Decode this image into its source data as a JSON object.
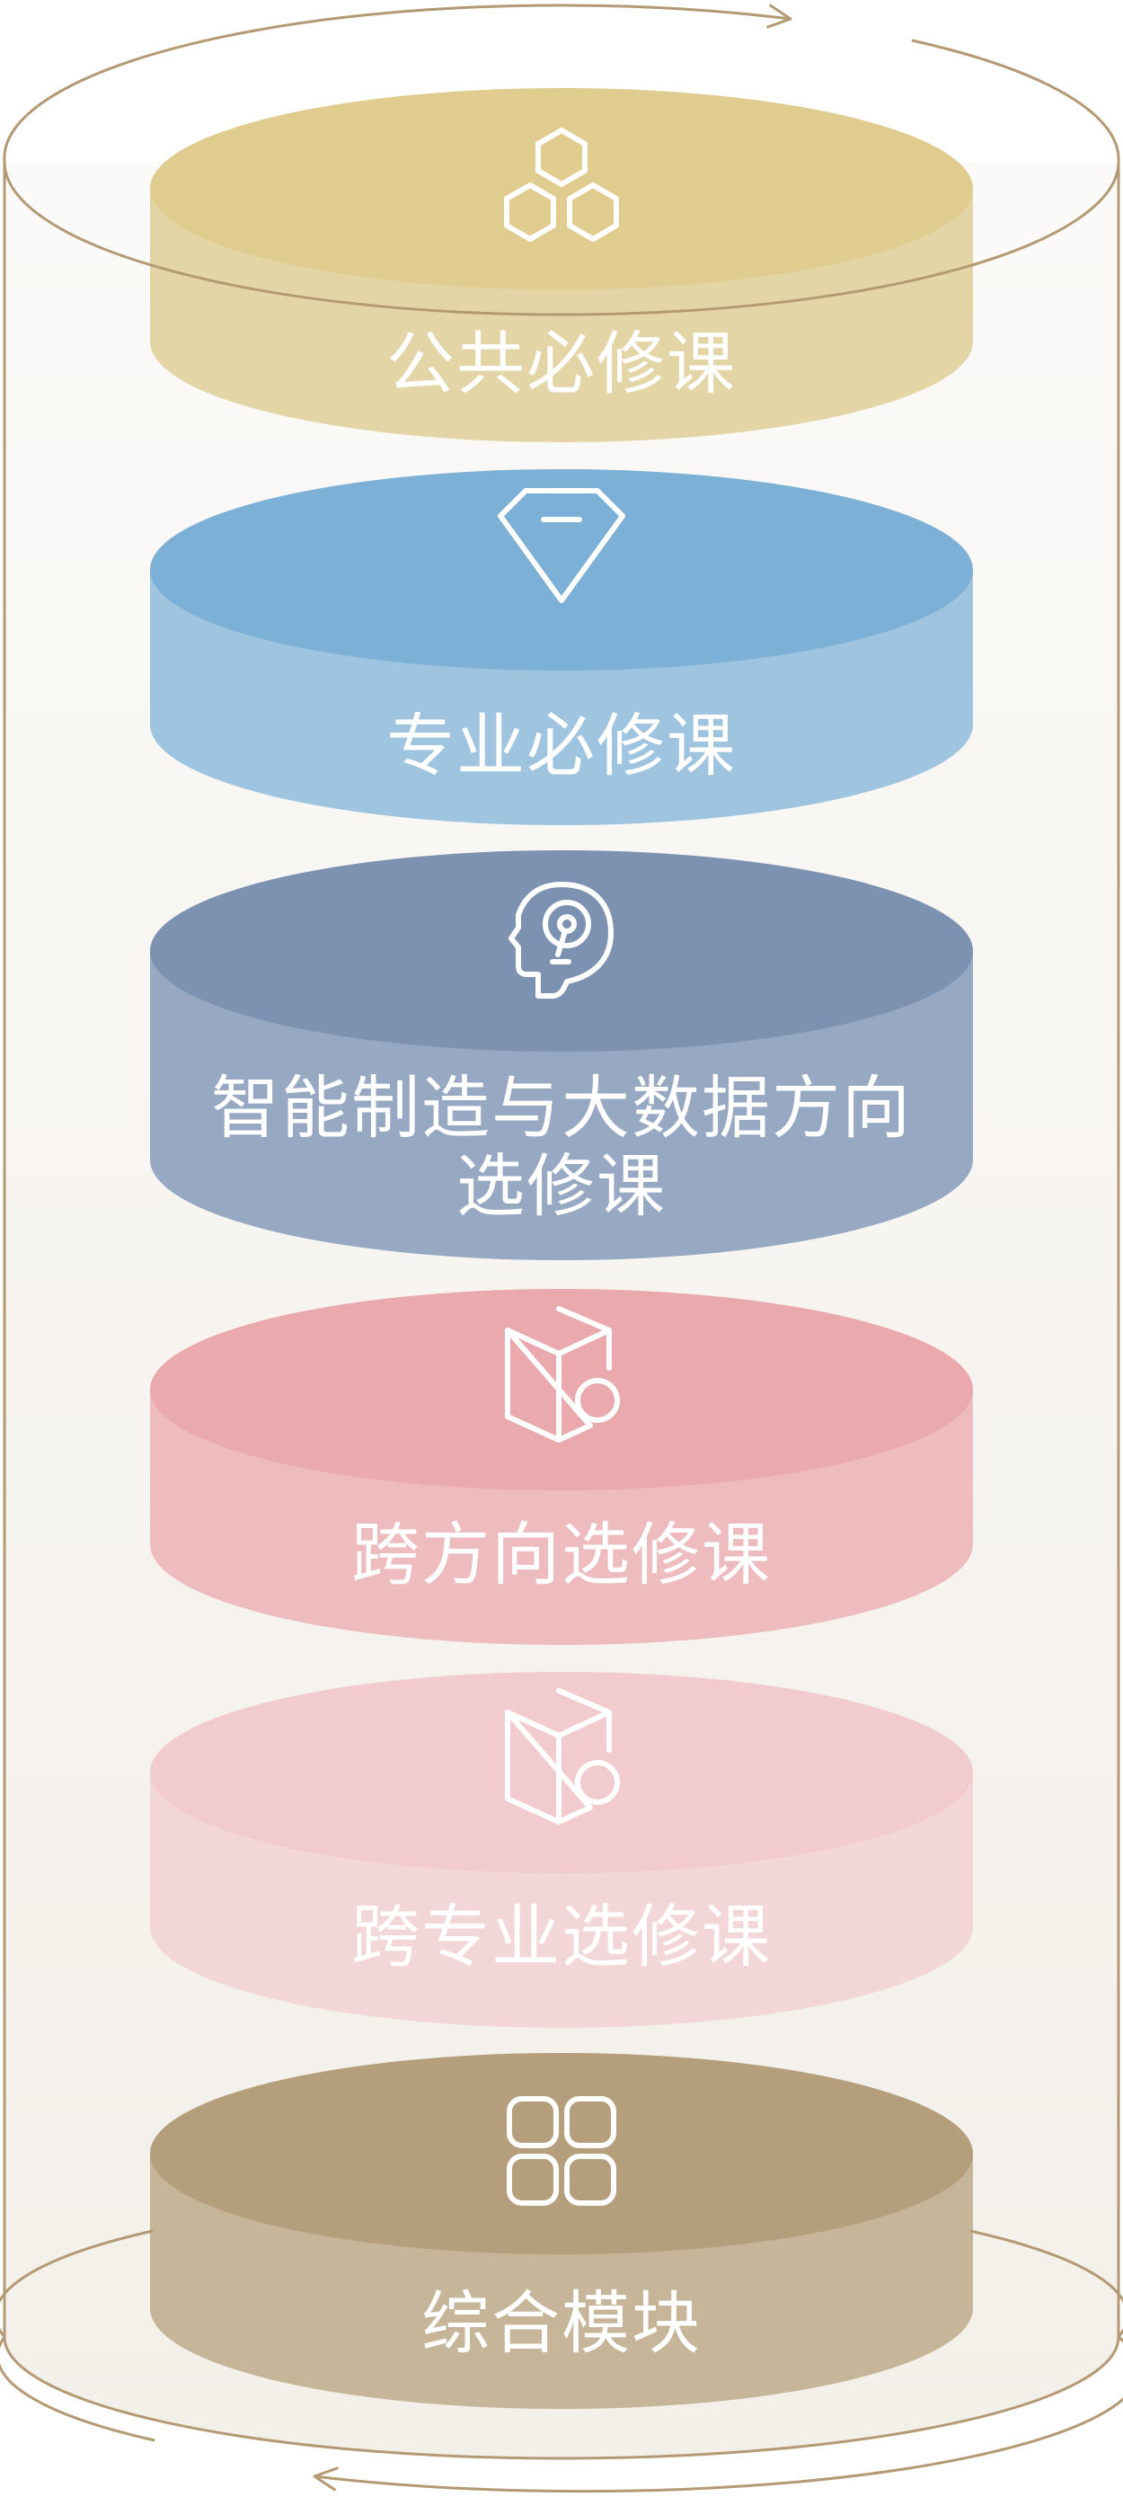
{
  "diagram": {
    "colors": {
      "outline": "#b39a74",
      "cylinder_fill_top": "#fbfaf8",
      "cylinder_fill_bottom": "#f3efe9",
      "label": "#ffffff"
    },
    "tiers": [
      {
        "id": "public-required",
        "lines": [
          "公共必修课"
        ],
        "icon": "hexagons-icon",
        "top_color": "#dfcc8e",
        "side_color": "#e4d5a6"
      },
      {
        "id": "major-required",
        "lines": [
          "专业必修课"
        ],
        "icon": "diamond-icon",
        "top_color": "#7db0d6",
        "side_color": "#9fc4e0"
      },
      {
        "id": "direction-elective",
        "lines": [
          "智能制造与大数据方向",
          "选修课"
        ],
        "icon": "head-idea-icon",
        "top_color": "#7d92b1",
        "side_color": "#96a8c2"
      },
      {
        "id": "cross-direction-elective",
        "lines": [
          "跨方向选修课"
        ],
        "icon": "cube-circle-icon",
        "top_color": "#eaaaad",
        "side_color": "#eebbbe"
      },
      {
        "id": "cross-major-elective",
        "lines": [
          "跨专业选修课"
        ],
        "icon": "cube-circle-icon",
        "top_color": "#f1cbcd",
        "side_color": "#f3d6d8"
      },
      {
        "id": "comprehensive-module",
        "lines": [
          "综合模块"
        ],
        "icon": "four-squares-icon",
        "top_color": "#b49e7b",
        "side_color": "#c6b599"
      }
    ]
  }
}
